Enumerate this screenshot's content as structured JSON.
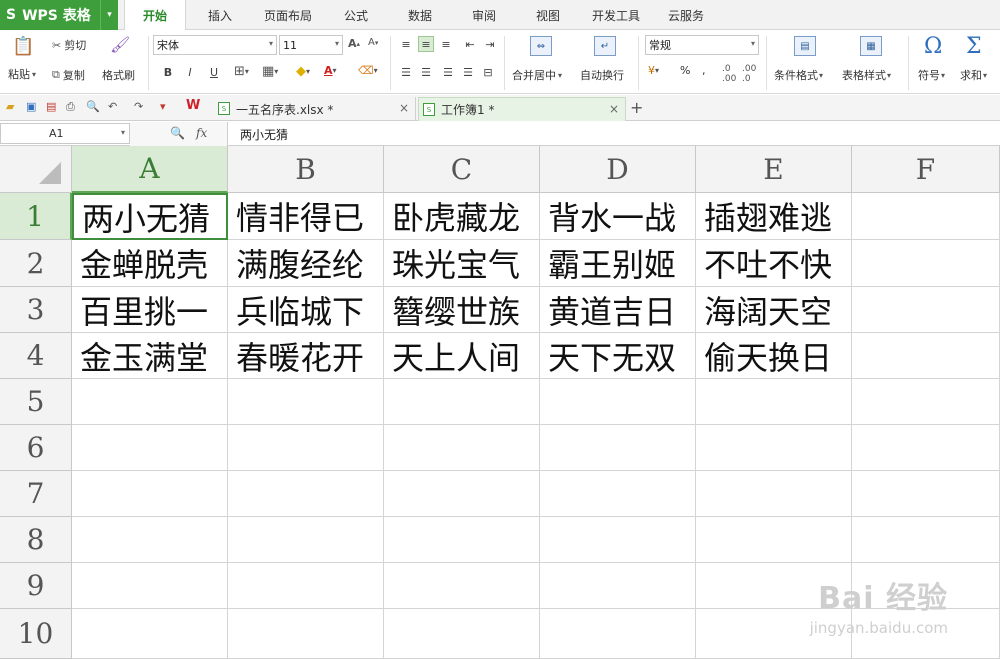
{
  "app": {
    "brand": "WPS 表格"
  },
  "menu_tabs": [
    "开始",
    "插入",
    "页面布局",
    "公式",
    "数据",
    "审阅",
    "视图",
    "开发工具",
    "云服务"
  ],
  "active_menu_tab": "开始",
  "ribbon": {
    "paste": "粘贴",
    "cut": "剪切",
    "copy": "复制",
    "format_painter": "格式刷",
    "font_name": "宋体",
    "font_size": "11",
    "bold": "B",
    "italic": "I",
    "underline": "U",
    "merge_center": "合并居中",
    "wrap_text": "自动换行",
    "number_format": "常规",
    "percent": "%",
    "comma": ",",
    "conditional_format": "条件格式",
    "table_style": "表格样式",
    "symbol": "符号",
    "sum": "求和"
  },
  "doc_tabs": [
    {
      "label": "一五名序表.xlsx *",
      "active": false
    },
    {
      "label": "工作簿1 *",
      "active": true
    }
  ],
  "formula_bar": {
    "name_box": "A1",
    "fx": "fx",
    "content": "两小无猜"
  },
  "sheet": {
    "columns": [
      "A",
      "B",
      "C",
      "D",
      "E",
      "F"
    ],
    "rows": [
      "1",
      "2",
      "3",
      "4",
      "5",
      "6",
      "7",
      "8",
      "9",
      "10"
    ],
    "active_cell": "A1",
    "cells": [
      [
        "两小无猜",
        "情非得已",
        "卧虎藏龙",
        "背水一战",
        "插翅难逃",
        ""
      ],
      [
        "金蝉脱壳",
        "满腹经纶",
        "珠光宝气",
        "霸王别姬",
        "不吐不快",
        ""
      ],
      [
        "百里挑一",
        "兵临城下",
        "簪缨世族",
        "黄道吉日",
        "海阔天空",
        ""
      ],
      [
        "金玉满堂",
        "春暖花开",
        "天上人间",
        "天下无双",
        "偷天换日",
        ""
      ]
    ]
  },
  "watermark": {
    "main": "Bai 经验",
    "url": "jingyan.baidu.com"
  }
}
